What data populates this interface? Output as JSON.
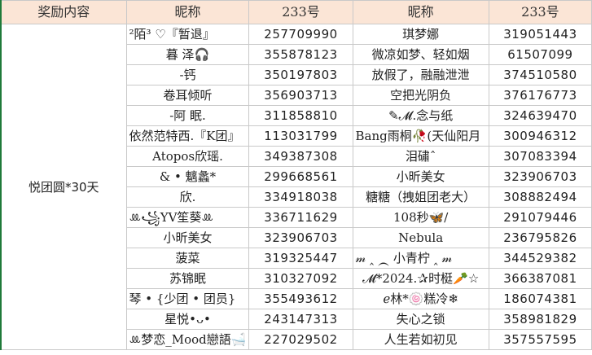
{
  "headers": [
    "奖励内容",
    "昵称",
    "233号",
    "昵称",
    "233号"
  ],
  "reward": "悦团圆*30天",
  "rows": [
    {
      "n1": "²陌³ ♡『暂退』",
      "id1": "257709990",
      "n2": "琪梦娜",
      "id2": "319051443"
    },
    {
      "n1": "暮 泽🎧",
      "id1": "355878123",
      "n2": "微凉如梦、轻如烟",
      "id2": "61507099"
    },
    {
      "n1": "-钙",
      "id1": "350197803",
      "n2": "放假了，融融泄泄",
      "id2": "374510580"
    },
    {
      "n1": "卷耳倾听",
      "id1": "356903713",
      "n2": "空把光阴负",
      "id2": "376176773"
    },
    {
      "n1": "-阿 眠.",
      "id1": "311858810",
      "n2": "✎𝓜.念与纸",
      "id2": "324639470"
    },
    {
      "n1": "依然范特西.『K团』",
      "id1": "113031799",
      "n2": "Bang雨桐🥀(天仙阳月",
      "id2": "300946312"
    },
    {
      "n1": "Atopos欣瑶.",
      "id1": "349387308",
      "n2": "泪䃤ˆ",
      "id2": "307083394"
    },
    {
      "n1": "& • 魑蠡*",
      "id1": "299668561",
      "n2": "小昕美女",
      "id2": "323906703"
    },
    {
      "n1": "欣.",
      "id1": "334918038",
      "n2": "糖糖（拽姐团老大）",
      "id2": "308882494"
    },
    {
      "n1": "ꔛ꧁YV笙葵ꔛ",
      "id1": "336711629",
      "n2": "108秒🦋/",
      "id2": "291079446"
    },
    {
      "n1": "小昕美女",
      "id1": "323906703",
      "n2": "Nebula",
      "id2": "236795826"
    },
    {
      "n1": "菠菜",
      "id1": "319325447",
      "n2": "𝓂 ‸ ⁔ 小青柠 ‸ 𝓂",
      "id2": "344529382"
    },
    {
      "n1": "苏锦眠",
      "id1": "310327092",
      "n2": "𝓜*2024.✰时梃🥕☆",
      "id2": "366387081"
    },
    {
      "n1": "琴 • {少团 • 团员}",
      "id1": "355493612",
      "n2": "ℯ林*🍥糕冷❄",
      "id2": "186074381"
    },
    {
      "n1": "星悦•ᴗ•",
      "id1": "243147313",
      "n2": "失心之锁",
      "id2": "358981829"
    },
    {
      "n1": "ꔛ梦恋_Mood戀語🛁",
      "id1": "227029502",
      "n2": "人生若如初见",
      "id2": "357557595"
    }
  ]
}
